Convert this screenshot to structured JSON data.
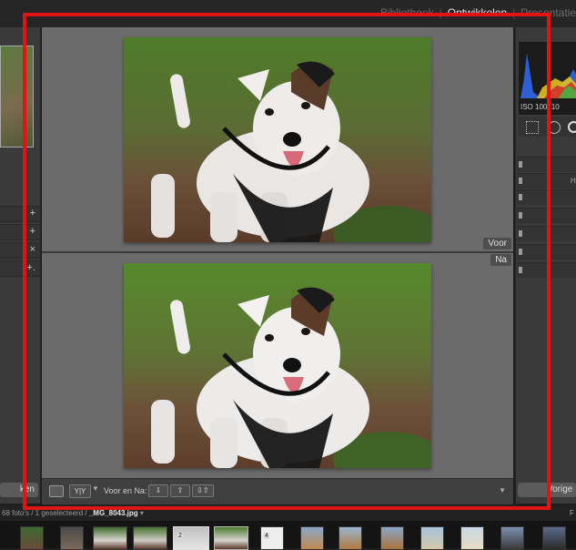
{
  "modules": {
    "items": [
      "Bibliotheek",
      "Ontwikkelen",
      "Presentatie"
    ],
    "active_index": 1,
    "separator": "|"
  },
  "left_panel": {
    "row_icons": [
      "+",
      "+",
      "×",
      "+."
    ],
    "bottom_button": "ken"
  },
  "view": {
    "before_label": "Voor",
    "after_label": "Na"
  },
  "toolbar": {
    "mode_label": "Voor en Na:",
    "yy_label": "Y|Y"
  },
  "right_panel": {
    "iso_text": "ISO 100",
    "iso_text_2": "10",
    "row_letter": "H",
    "bottom_button": "Vorige"
  },
  "status": {
    "prefix": "68 foto's / 1 geselecteerd /",
    "filename": "_MG_8043.jpg",
    "suffix": "▾",
    "right_letter": "F"
  },
  "filmstrip": {
    "numbers": [
      "2",
      "4"
    ]
  },
  "colors": {
    "annotation": "#e11414",
    "view_background": "#6b6b6b",
    "active_module": "#e6e6e6"
  }
}
